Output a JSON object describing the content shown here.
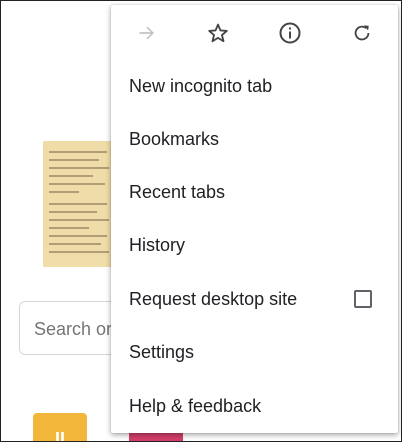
{
  "background_page": {
    "search_placeholder": "Search or",
    "tile_letter": "II"
  },
  "menu": {
    "toolbar": {
      "forward_icon": "arrow-forward-icon",
      "bookmark_icon": "star-outline-icon",
      "info_icon": "info-icon",
      "reload_icon": "refresh-icon"
    },
    "items": [
      {
        "label": "New incognito tab"
      },
      {
        "label": "Bookmarks"
      },
      {
        "label": "Recent tabs"
      },
      {
        "label": "History"
      },
      {
        "label": "Request desktop site",
        "checkbox": false
      },
      {
        "label": "Settings"
      },
      {
        "label": "Help & feedback"
      }
    ]
  },
  "colors": {
    "disabled_icon": "#c4c4c4",
    "icon": "#444444",
    "text": "#202124",
    "tile_yellow": "#f1b63a",
    "tile_pink": "#d43f6a"
  }
}
